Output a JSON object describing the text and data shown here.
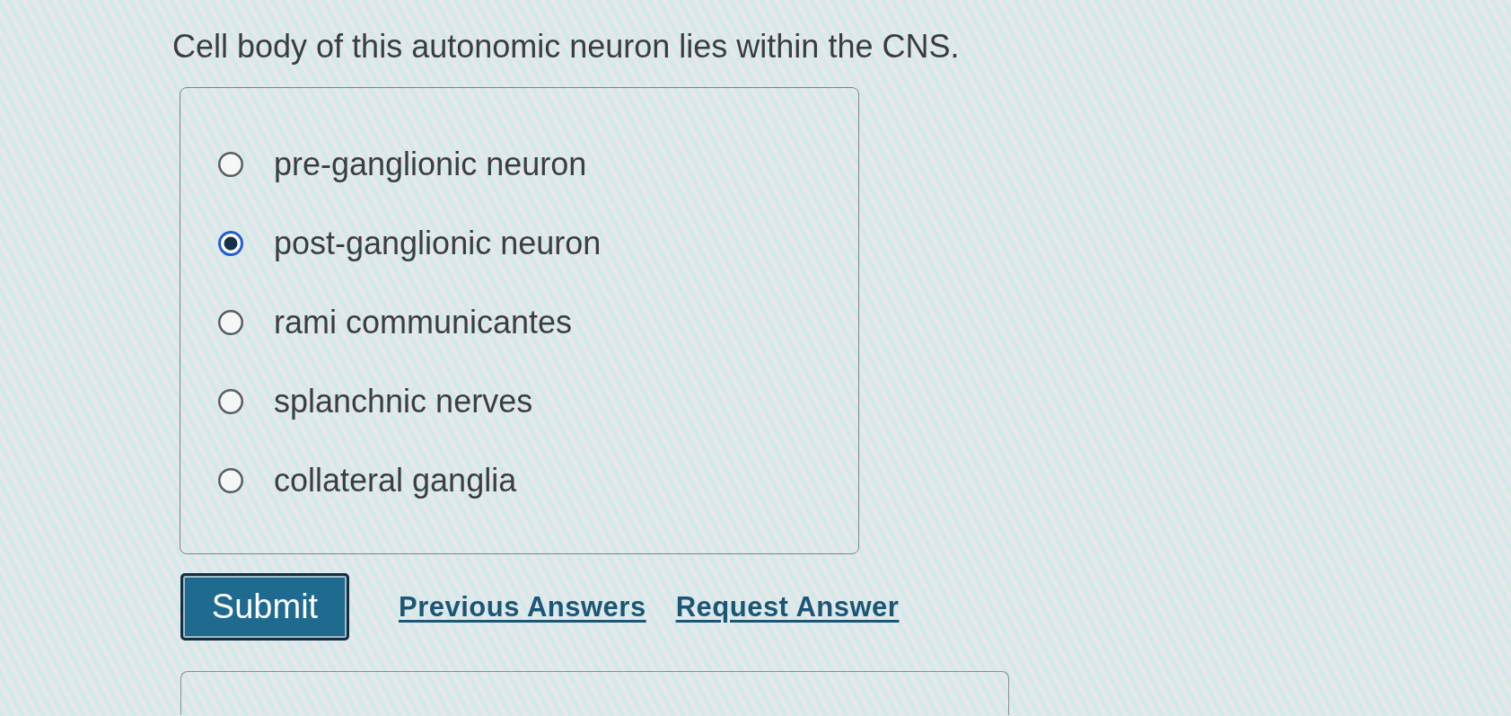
{
  "question": "Cell body of this autonomic neuron lies within the CNS.",
  "options": [
    {
      "label": "pre-ganglionic neuron",
      "selected": false
    },
    {
      "label": "post-ganglionic neuron",
      "selected": true
    },
    {
      "label": "rami communicantes",
      "selected": false
    },
    {
      "label": "splanchnic nerves",
      "selected": false
    },
    {
      "label": "collateral ganglia",
      "selected": false
    }
  ],
  "actions": {
    "submit_button": "Submit",
    "links": [
      "Previous Answers",
      "Request Answer"
    ]
  }
}
